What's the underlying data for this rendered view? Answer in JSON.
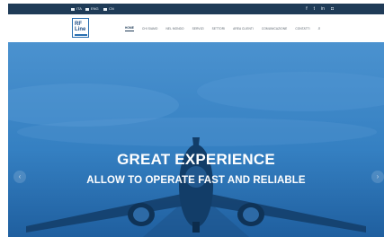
{
  "topbar": {
    "languages": [
      {
        "code": "ITA",
        "icon": "flag-icon"
      },
      {
        "code": "ENG",
        "icon": "flag-icon"
      },
      {
        "code": "CN",
        "icon": "flag-icon"
      }
    ],
    "social": [
      {
        "name": "facebook-icon",
        "glyph": "f"
      },
      {
        "name": "twitter-icon",
        "glyph": "t"
      },
      {
        "name": "linkedin-icon",
        "glyph": "in"
      },
      {
        "name": "instagram-icon",
        "glyph": "◘"
      }
    ]
  },
  "logo": {
    "line1": "RF",
    "line2": "Line"
  },
  "nav": {
    "items": [
      "HOME",
      "CHI SIAMO",
      "NEL MONDO",
      "SERVIZI",
      "SETTORI",
      "AREA CLIENTI",
      "COMUNICAZIONE",
      "CONTATTI"
    ],
    "active_index": 0
  },
  "hero": {
    "headline": "GREAT EXPERIENCE",
    "subheadline": "ALLOW TO OPERATE FAST AND RELIABLE"
  },
  "colors": {
    "topbar": "#1f3b57",
    "hero": "#2f79bb",
    "accent": "#2a6fb0"
  }
}
